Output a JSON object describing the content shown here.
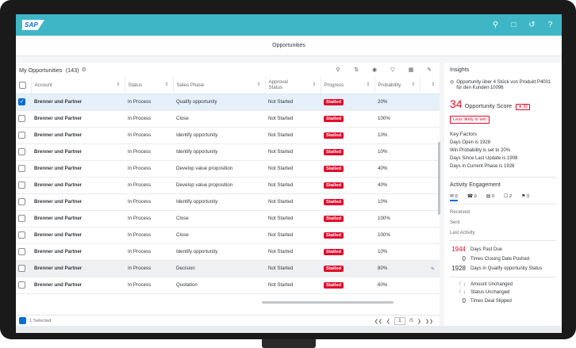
{
  "shell": {
    "logo": "SAP",
    "icons": [
      "search-icon",
      "feedback-icon",
      "history-icon",
      "help-icon"
    ]
  },
  "page_title": "Opportunities",
  "table": {
    "title": "My Opportunities",
    "count": "(143)",
    "headers": {
      "account": "Account",
      "status": "Status",
      "sales_phase": "Sales Phase",
      "approval_status": "Approval Status",
      "progress": "Progress",
      "probability": "Probability"
    },
    "rows": [
      {
        "account": "Brenner und Partner",
        "status": "In Process",
        "phase": "Qualify opportunity",
        "approval": "Not Started",
        "progress": "Stalled",
        "probability": "20%"
      },
      {
        "account": "Brenner und Partner",
        "status": "In Process",
        "phase": "Close",
        "approval": "Not Started",
        "progress": "Stalled",
        "probability": "100%"
      },
      {
        "account": "Brenner und Partner",
        "status": "In Process",
        "phase": "Identify opportunity",
        "approval": "Not Started",
        "progress": "Stalled",
        "probability": "10%"
      },
      {
        "account": "Brenner und Partner",
        "status": "In Process",
        "phase": "Identify opportunity",
        "approval": "Not Started",
        "progress": "Stalled",
        "probability": "10%"
      },
      {
        "account": "Brenner und Partner",
        "status": "In Process",
        "phase": "Develop value proposition",
        "approval": "Not Started",
        "progress": "Stalled",
        "probability": "40%"
      },
      {
        "account": "Brenner und Partner",
        "status": "In Process",
        "phase": "Develop value proposition",
        "approval": "Not Started",
        "progress": "Stalled",
        "probability": "40%"
      },
      {
        "account": "Brenner und Partner",
        "status": "In Process",
        "phase": "Identify opportunity",
        "approval": "Not Started",
        "progress": "Stalled",
        "probability": "10%"
      },
      {
        "account": "Brenner und Partner",
        "status": "In Process",
        "phase": "Close",
        "approval": "Not Started",
        "progress": "Stalled",
        "probability": "100%"
      },
      {
        "account": "Brenner und Partner",
        "status": "In Process",
        "phase": "Close",
        "approval": "Not Started",
        "progress": "Stalled",
        "probability": "100%"
      },
      {
        "account": "Brenner und Partner",
        "status": "In Process",
        "phase": "Identify opportunity",
        "approval": "Not Started",
        "progress": "Stalled",
        "probability": "10%"
      },
      {
        "account": "Brenner und Partner",
        "status": "In Process",
        "phase": "Decision",
        "approval": "Not Started",
        "progress": "Stalled",
        "probability": "80%"
      },
      {
        "account": "Brenner und Partner",
        "status": "In Process",
        "phase": "Quotation",
        "approval": "Not Started",
        "progress": "Stalled",
        "probability": "60%"
      }
    ],
    "selected_count": "1 Selected",
    "pager": {
      "current": "1",
      "total": "/5"
    }
  },
  "insights": {
    "title": "Insights",
    "opportunity": "Opportunity über 4 Stück von Produkt P4001 für den Kunden 10096",
    "score_value": "34",
    "score_label": "Opportunity Score",
    "score_delta": "▼ 66",
    "likelihood": "Less likely to win",
    "key_factors_title": "Key Factors",
    "key_factors": [
      "Days Open is 1928",
      "Win Probability is set to 20%",
      "Days Since Last Update is 1908",
      "Days in Current Phase is 1928"
    ],
    "activity_title": "Activity Engagement",
    "activity_tabs": [
      "0",
      "0",
      "0",
      "2",
      "0"
    ],
    "activity_items": [
      "Received",
      "Sent",
      "Last Activity"
    ],
    "stats": [
      {
        "n": "1944",
        "label": "Days Past Due"
      },
      {
        "n": "0",
        "label": "Times Closing Date Pushed"
      },
      {
        "n": "1928",
        "label": "Days in Qualify opportunity Status"
      }
    ],
    "trends": [
      "Amount Unchanged",
      "Status Unchanged",
      "Times Deal Slipped"
    ],
    "trend_last_value": "0"
  },
  "colors": {
    "shell": "#3fb6c6",
    "accent": "#0a6ed1",
    "negative": "#e00d2c"
  }
}
